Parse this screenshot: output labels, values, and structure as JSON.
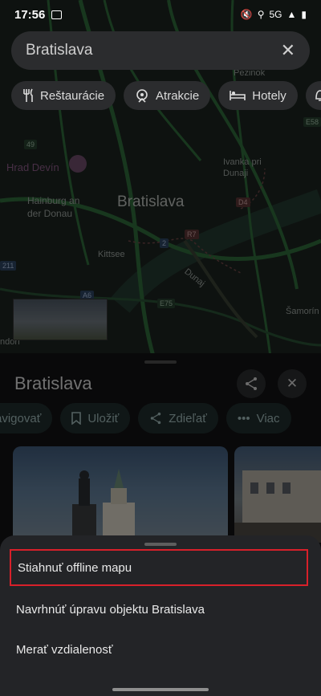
{
  "status_bar": {
    "time": "17:56",
    "network": "5G"
  },
  "search": {
    "value": "Bratislava"
  },
  "chips": [
    {
      "label": "Reštaurácie",
      "icon": "restaurant-icon"
    },
    {
      "label": "Atrakcie",
      "icon": "attractions-icon"
    },
    {
      "label": "Hotely",
      "icon": "hotel-icon"
    }
  ],
  "map": {
    "city": "Bratislava",
    "poi": "Hrad Devín",
    "labels": [
      "Pezinok",
      "Ivanka pri Dunaji",
      "Hainburg an der Donau",
      "Kittsee",
      "Šamorín",
      "Dunaj",
      "ndorf"
    ],
    "roads": [
      "49",
      "D4",
      "R7",
      "2",
      "A6",
      "E75",
      "211",
      "E58"
    ]
  },
  "place": {
    "title": "Bratislava",
    "actions": [
      {
        "label": "avigovať",
        "icon": "navigate-icon"
      },
      {
        "label": "Uložiť",
        "icon": "bookmark-icon"
      },
      {
        "label": "Zdieľať",
        "icon": "share-icon"
      },
      {
        "label": "Viac",
        "icon": "more-icon"
      }
    ]
  },
  "menu": {
    "items": [
      {
        "label": "Stiahnuť offline mapu",
        "highlighted": true
      },
      {
        "label": "Navrhnúť úpravu objektu Bratislava",
        "highlighted": false
      },
      {
        "label": "Merať vzdialenosť",
        "highlighted": false
      }
    ]
  },
  "colors": {
    "highlight": "#d8202a",
    "map_background": "#1c2420",
    "road": "#2f6a3a"
  }
}
